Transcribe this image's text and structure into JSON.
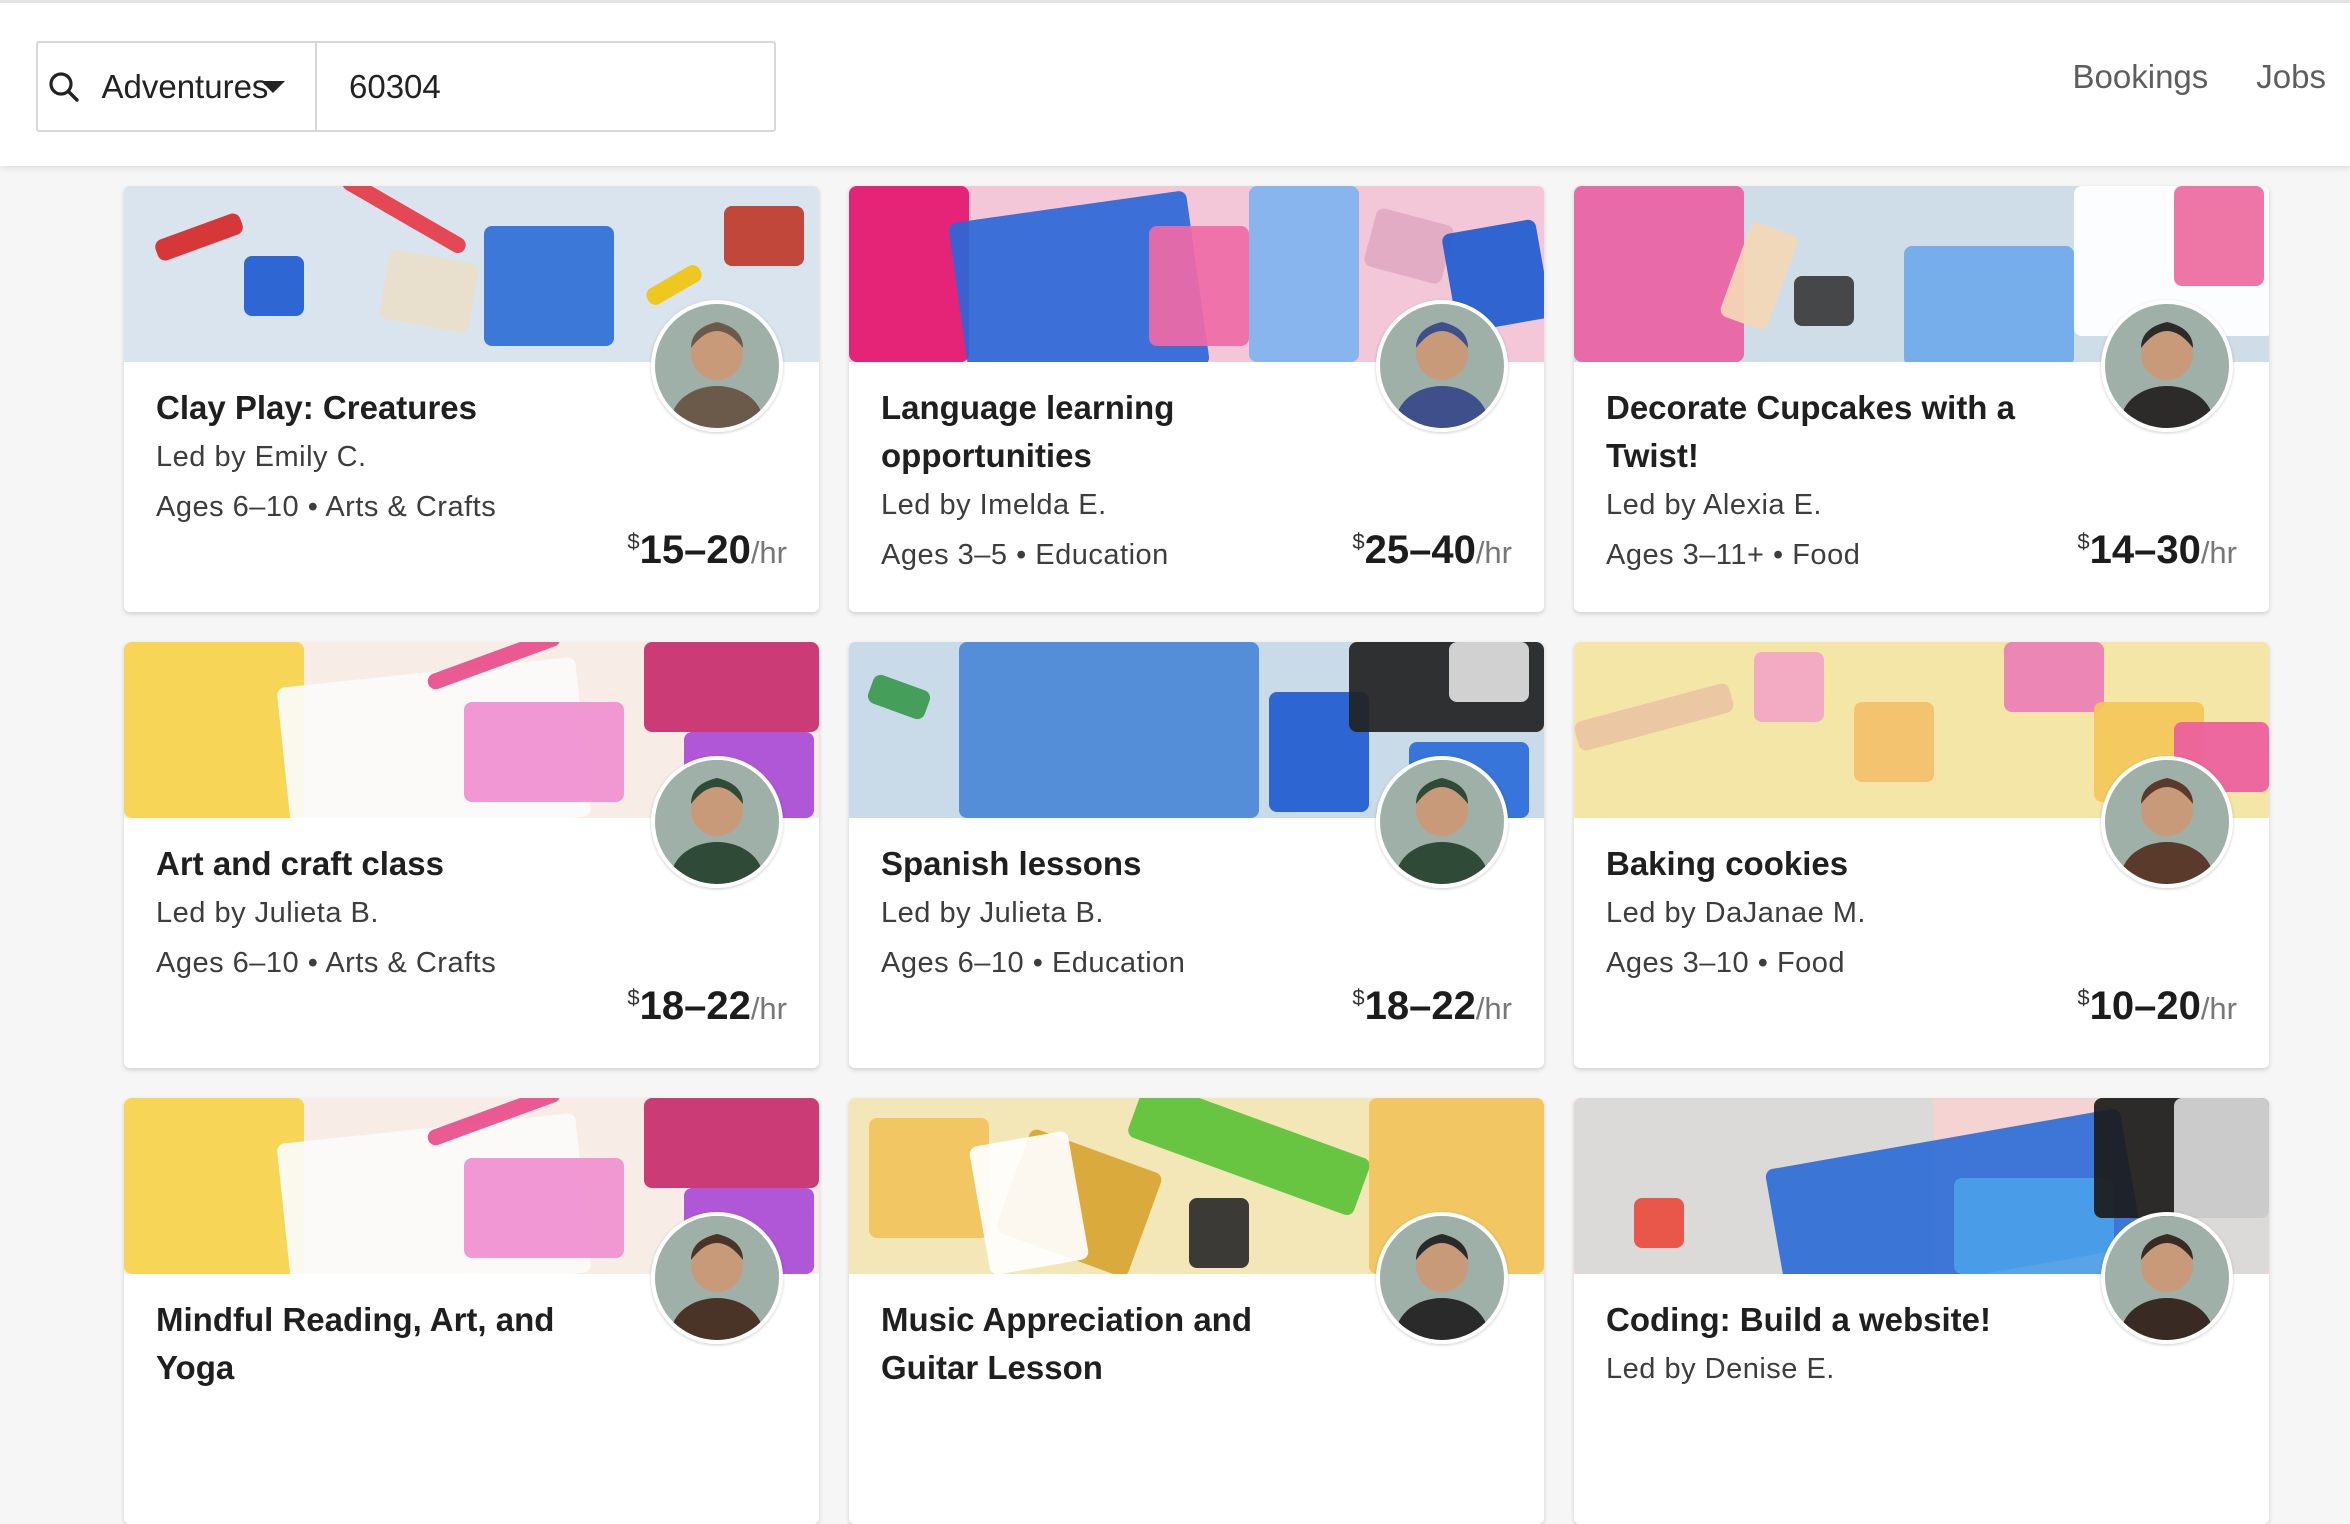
{
  "search": {
    "category": "Adventures",
    "zip": "60304"
  },
  "nav": {
    "bookings": "Bookings",
    "jobs": "Jobs"
  },
  "cards": [
    {
      "title": "Clay Play: Creatures",
      "leader": "Led by Emily C.",
      "meta": "Ages 6–10 • Arts & Crafts",
      "price_cur": "$",
      "price": "15–20",
      "price_unit": "/hr",
      "theme": "arts",
      "avatar_color": "#6b5a4a"
    },
    {
      "title": "Language learning opportunities",
      "leader": "Led by Imelda E.",
      "meta": "Ages 3–5 • Education",
      "price_cur": "$",
      "price": "25–40",
      "price_unit": "/hr",
      "theme": "school",
      "avatar_color": "#3e4f8c"
    },
    {
      "title": "Decorate Cupcakes with a Twist!",
      "leader": "Led by Alexia E.",
      "meta": "Ages 3–11+ • Food",
      "price_cur": "$",
      "price": "14–30",
      "price_unit": "/hr",
      "theme": "baking",
      "avatar_color": "#2d2a2a"
    },
    {
      "title": "Art and craft class",
      "leader": "Led by Julieta B.",
      "meta": "Ages 6–10 • Arts & Crafts",
      "price_cur": "$",
      "price": "18–22",
      "price_unit": "/hr",
      "theme": "drawing",
      "avatar_color": "#2f4a36"
    },
    {
      "title": "Spanish lessons",
      "leader": "Led by Julieta B.",
      "meta": "Ages 6–10 • Education",
      "price_cur": "$",
      "price": "18–22",
      "price_unit": "/hr",
      "theme": "games",
      "avatar_color": "#2f4a36"
    },
    {
      "title": "Baking cookies",
      "leader": "Led by DaJanae M.",
      "meta": "Ages 3–10 • Food",
      "price_cur": "$",
      "price": "10–20",
      "price_unit": "/hr",
      "theme": "cookies",
      "avatar_color": "#5a3a2a"
    },
    {
      "title": "Mindful Reading, Art, and Yoga",
      "leader": "",
      "meta": "",
      "price_cur": "",
      "price": "",
      "price_unit": "",
      "theme": "drawing",
      "avatar_color": "#4a3428"
    },
    {
      "title": "Music Appreciation and Guitar Lesson",
      "leader": "",
      "meta": "",
      "price_cur": "",
      "price": "",
      "price_unit": "",
      "theme": "music",
      "avatar_color": "#2a2a2a"
    },
    {
      "title": "Coding: Build a website!",
      "leader": "Led by Denise E.",
      "meta": "",
      "price_cur": "",
      "price": "",
      "price_unit": "",
      "theme": "coding",
      "avatar_color": "#3a2a24"
    }
  ]
}
